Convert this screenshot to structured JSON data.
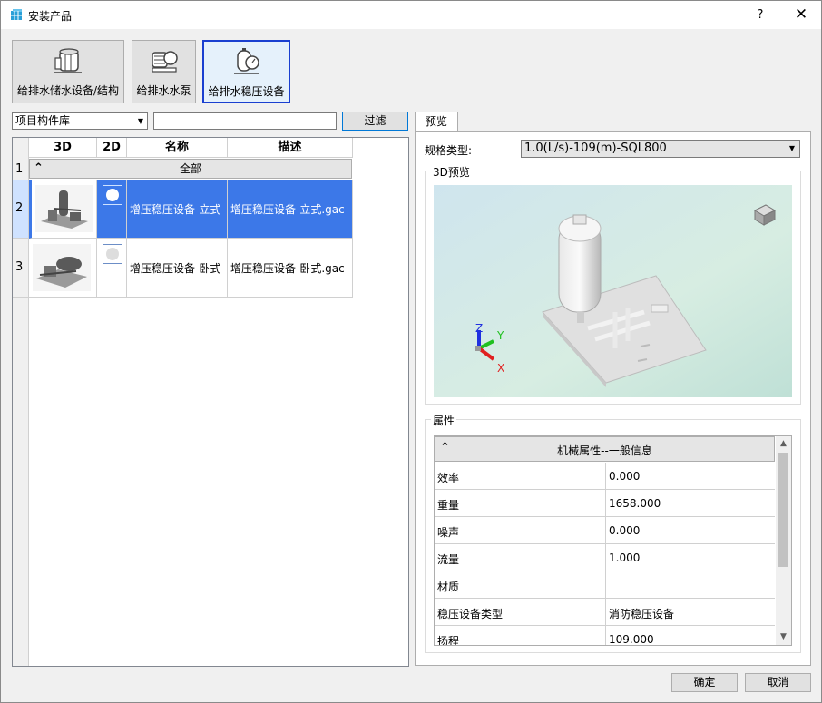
{
  "window": {
    "title": "安装产品",
    "help_label": "?",
    "close_label": "✕"
  },
  "categories": [
    {
      "label": "给排水储水设备/结构",
      "icon": "water-tank-icon",
      "selected": false
    },
    {
      "label": "给排水水泵",
      "icon": "pump-icon",
      "selected": false
    },
    {
      "label": "给排水稳压设备",
      "icon": "pressure-tank-icon",
      "selected": true
    }
  ],
  "filter": {
    "library": "项目构件库",
    "input_value": "",
    "button_label": "过滤"
  },
  "grid": {
    "headers": [
      "3D",
      "2D",
      "名称",
      "描述"
    ],
    "group": {
      "row_number": "1",
      "label": "全部"
    },
    "rows": [
      {
        "row_number": "2",
        "name": "增压稳压设备-立式",
        "desc": "增压稳压设备-立式.gac",
        "selected": true
      },
      {
        "row_number": "3",
        "name": "增压稳压设备-卧式",
        "desc": "增压稳压设备-卧式.gac",
        "selected": false
      }
    ]
  },
  "preview": {
    "tab_label": "预览",
    "spec_label": "规格类型:",
    "spec_value": "1.0(L/s)-109(m)-SQL800",
    "view3d_title": "3D预览",
    "axes": {
      "x": "X",
      "y": "Y",
      "z": "Z"
    },
    "colors": {
      "x": "#e02020",
      "y": "#20c020",
      "z": "#2030e0"
    }
  },
  "properties": {
    "title": "属性",
    "section": "机械属性--一般信息",
    "rows": [
      {
        "name": "效率",
        "value": "0.000"
      },
      {
        "name": "重量",
        "value": "1658.000"
      },
      {
        "name": "噪声",
        "value": "0.000"
      },
      {
        "name": "流量",
        "value": "1.000"
      },
      {
        "name": "材质",
        "value": ""
      },
      {
        "name": "稳压设备类型",
        "value": "消防稳压设备"
      },
      {
        "name": "扬程",
        "value": "109.000"
      }
    ]
  },
  "footer": {
    "ok_label": "确定",
    "cancel_label": "取消"
  }
}
